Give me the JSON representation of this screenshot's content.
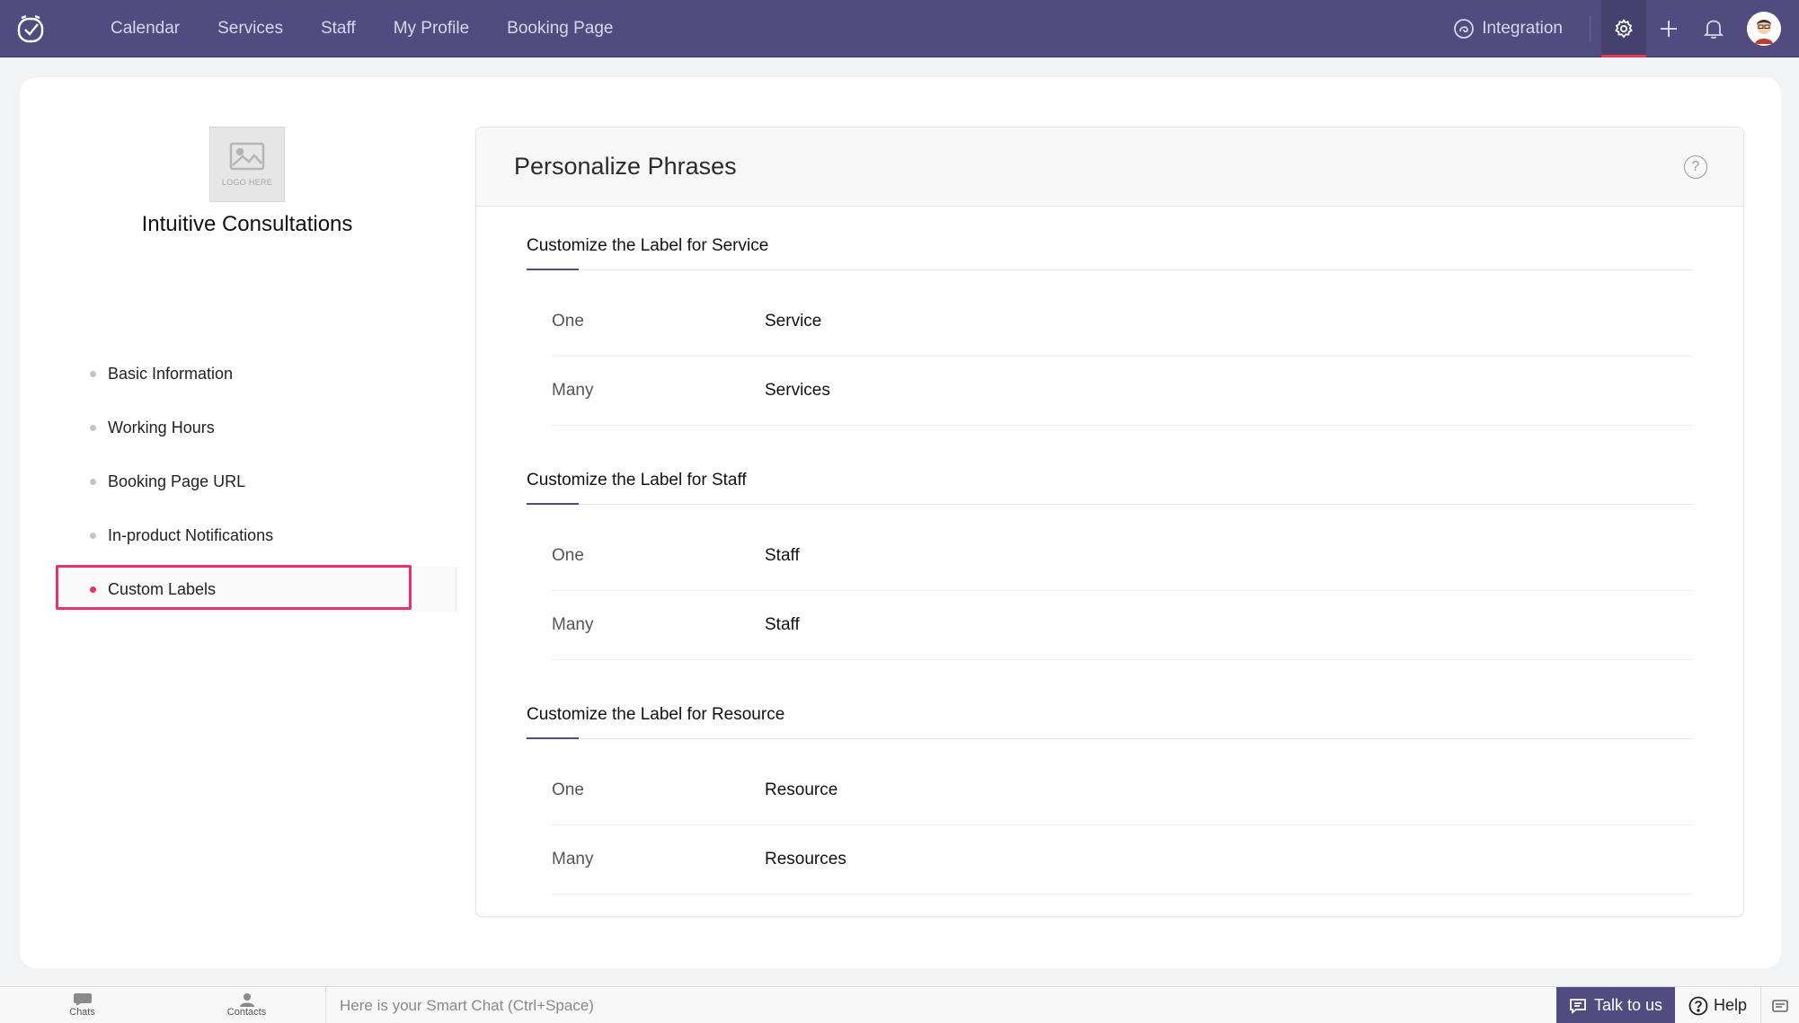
{
  "nav": {
    "items": [
      "Calendar",
      "Services",
      "Staff",
      "My Profile",
      "Booking Page"
    ],
    "integration_label": "Integration",
    "icons": [
      "settings-icon",
      "plus-icon",
      "bell-icon"
    ],
    "accent": "#514b80",
    "active_indicator": "#e53a4a"
  },
  "business": {
    "logo_placeholder": "LOGO HERE",
    "name": "Intuitive Consultations"
  },
  "sidebar": {
    "items": [
      {
        "label": "Basic Information"
      },
      {
        "label": "Working Hours"
      },
      {
        "label": "Booking Page URL"
      },
      {
        "label": "In-product Notifications"
      },
      {
        "label": "Custom Labels"
      }
    ],
    "active_index": 4,
    "active_color": "#e8336a"
  },
  "panel": {
    "title": "Personalize Phrases",
    "help": "?",
    "sections": [
      {
        "title": "Customize the Label for Service",
        "rows": [
          {
            "key": "One",
            "value": "Service"
          },
          {
            "key": "Many",
            "value": "Services"
          }
        ]
      },
      {
        "title": "Customize the Label for Staff",
        "rows": [
          {
            "key": "One",
            "value": "Staff"
          },
          {
            "key": "Many",
            "value": "Staff"
          }
        ]
      },
      {
        "title": "Customize the Label for Resource",
        "rows": [
          {
            "key": "One",
            "value": "Resource"
          },
          {
            "key": "Many",
            "value": "Resources"
          }
        ]
      }
    ]
  },
  "bottombar": {
    "chats": "Chats",
    "contacts": "Contacts",
    "smart_chat_placeholder": "Here is your Smart Chat (Ctrl+Space)",
    "talk_label": "Talk to us",
    "help_label": "Help"
  }
}
